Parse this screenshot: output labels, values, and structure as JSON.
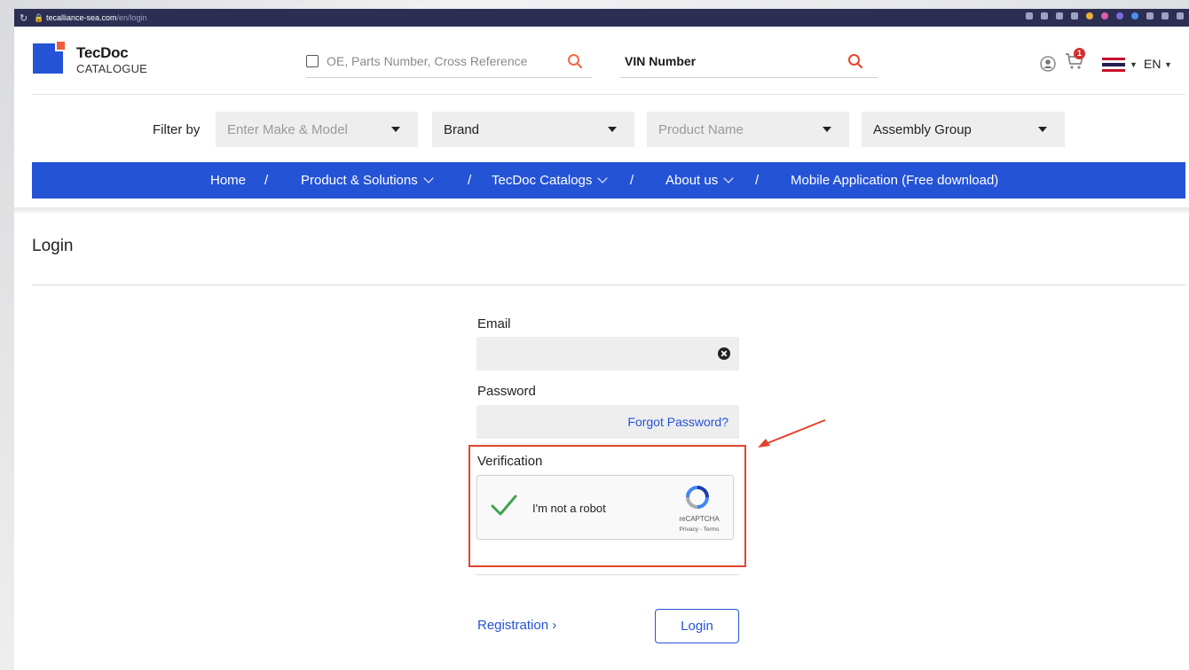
{
  "browser": {
    "url_host": "tecalliance-sea.com",
    "url_path": "/en/login"
  },
  "header": {
    "logo_line1": "TecDoc",
    "logo_line2": "CATALOGUE",
    "search_placeholder": "OE, Parts Number, Cross Reference",
    "vin_label": "VIN Number",
    "cart_count": "1",
    "language": "EN",
    "accent_color": "#2553d6",
    "logo_accent": "#ef5b3c"
  },
  "filters": {
    "label": "Filter by",
    "make_model_placeholder": "Enter Make & Model",
    "brand_value": "Brand",
    "product_name_placeholder": "Product Name",
    "assembly_group_value": "Assembly Group"
  },
  "nav": {
    "home": "Home",
    "products": "Product & Solutions",
    "catalogs": "TecDoc Catalogs",
    "about": "About us",
    "mobile": "Mobile Application (Free download)",
    "separator": "/"
  },
  "login": {
    "title": "Login",
    "email_label": "Email",
    "password_label": "Password",
    "forgot_password": "Forgot Password?",
    "verification_label": "Verification",
    "captcha_label": "I'm not a robot",
    "captcha_brand": "reCAPTCHA",
    "captcha_links": "Privacy - Terms",
    "registration_link": "Registration",
    "login_button": "Login",
    "highlight_color": "#e0442c"
  }
}
